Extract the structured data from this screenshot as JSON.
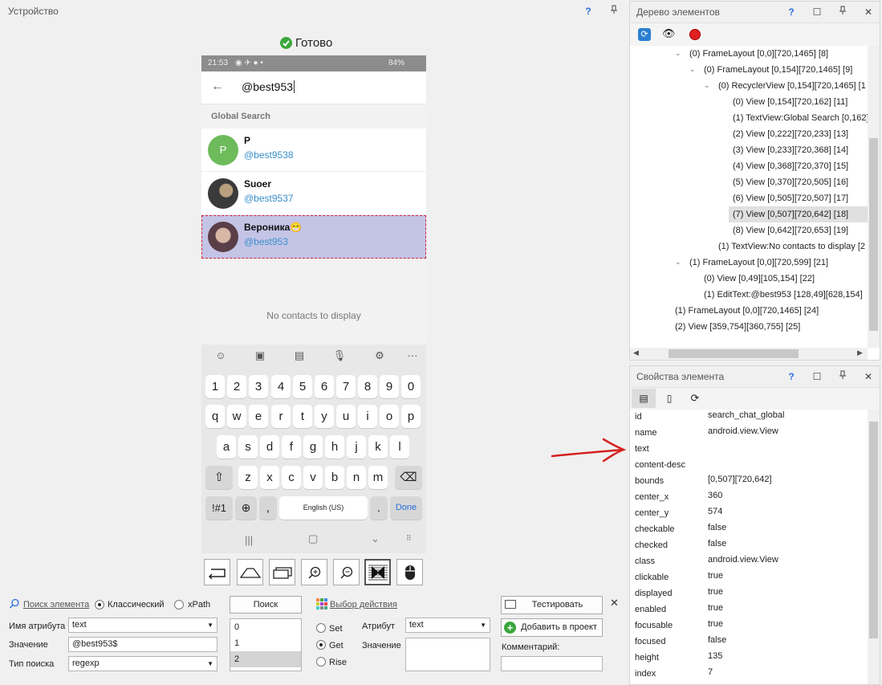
{
  "device_panel": {
    "title": "Устройство",
    "help": "?",
    "pin": "⊥",
    "status": "Готово"
  },
  "phone": {
    "statusbar": {
      "time": "21:53",
      "battery": "84%"
    },
    "search_text": "@best953",
    "section_label": "Global Search",
    "contacts": [
      {
        "initial": "P",
        "name": "P",
        "handle": "@best9538",
        "avatar_color": "#6dbb5a"
      },
      {
        "initial": "",
        "name": "Suoer",
        "handle": "@best9537",
        "avatar_color": "#4a4a4a"
      },
      {
        "initial": "",
        "name": "Вероника😁",
        "handle": "@best953",
        "avatar_color": "#6b4e57"
      }
    ],
    "empty_text": "No contacts to display",
    "keyboard": {
      "row_numbers": [
        "1",
        "2",
        "3",
        "4",
        "5",
        "6",
        "7",
        "8",
        "9",
        "0"
      ],
      "row_q": [
        "q",
        "w",
        "e",
        "r",
        "t",
        "y",
        "u",
        "i",
        "o",
        "p"
      ],
      "row_a": [
        "a",
        "s",
        "d",
        "f",
        "g",
        "h",
        "j",
        "k",
        "l"
      ],
      "row_z": [
        "z",
        "x",
        "c",
        "v",
        "b",
        "n",
        "m"
      ],
      "sym": "!#1",
      "comma": ",",
      "space": "English (US)",
      "period": ".",
      "done": "Done"
    }
  },
  "search_panel": {
    "search_link": "Поиск элемента",
    "mode_classic": "Классический",
    "mode_xpath": "xPath",
    "search_button": "Поиск",
    "attr_name_label": "Имя атрибута",
    "attr_name_value": "text",
    "value_label": "Значение",
    "value_value": "@best953$",
    "search_type_label": "Тип поиска",
    "search_type_value": "regexp",
    "results": [
      "0",
      "1",
      "2"
    ],
    "action_link": "Выбор действия",
    "set_label": "Set",
    "get_label": "Get",
    "rise_label": "Rise",
    "attribute_label": "Атрибут",
    "attribute_value": "text",
    "action_value_label": "Значение",
    "test_button": "Тестировать",
    "add_button": "Добавить в проект",
    "comment_label": "Комментарий:"
  },
  "tree_panel": {
    "title": "Дерево элементов",
    "help": "?",
    "rows": [
      {
        "text": "(0) FrameLayout [0,0][720,1465] [8]"
      },
      {
        "text": "(0) FrameLayout [0,154][720,1465] [9]"
      },
      {
        "text": "(0) RecyclerView [0,154][720,1465] [1"
      },
      {
        "text": "(0) View [0,154][720,162] [11]"
      },
      {
        "text": "(1) TextView:Global Search [0,162]"
      },
      {
        "text": "(2) View [0,222][720,233] [13]"
      },
      {
        "text": "(3) View [0,233][720,368] [14]"
      },
      {
        "text": "(4) View [0,368][720,370] [15]"
      },
      {
        "text": "(5) View [0,370][720,505] [16]"
      },
      {
        "text": "(6) View [0,505][720,507] [17]"
      },
      {
        "text": "(7) View [0,507][720,642] [18]"
      },
      {
        "text": "(8) View [0,642][720,653] [19]"
      },
      {
        "text": "(1) TextView:No contacts to display [2"
      },
      {
        "text": "(1) FrameLayout [0,0][720,599] [21]"
      },
      {
        "text": "(0) View [0,49][105,154] [22]"
      },
      {
        "text": "(1) EditText:@best953 [128,49][628,154]"
      },
      {
        "text": "(1) FrameLayout [0,0][720,1465] [24]"
      },
      {
        "text": "(2) View [359,754][360,755] [25]"
      }
    ]
  },
  "props_panel": {
    "title": "Свойства элемента",
    "help": "?",
    "rows": [
      {
        "key": "id",
        "value": "search_chat_global"
      },
      {
        "key": "name",
        "value": "android.view.View"
      },
      {
        "key": "text",
        "value": ""
      },
      {
        "key": "content-desc",
        "value": ""
      },
      {
        "key": "bounds",
        "value": "[0,507][720,642]"
      },
      {
        "key": "center_x",
        "value": "360"
      },
      {
        "key": "center_y",
        "value": "574"
      },
      {
        "key": "checkable",
        "value": "false"
      },
      {
        "key": "checked",
        "value": "false"
      },
      {
        "key": "class",
        "value": "android.view.View"
      },
      {
        "key": "clickable",
        "value": "true"
      },
      {
        "key": "displayed",
        "value": "true"
      },
      {
        "key": "enabled",
        "value": "true"
      },
      {
        "key": "focusable",
        "value": "true"
      },
      {
        "key": "focused",
        "value": "false"
      },
      {
        "key": "height",
        "value": "135"
      },
      {
        "key": "index",
        "value": "7"
      }
    ]
  },
  "colors": {
    "accent_blue": "#2a6fdb",
    "selection_fill": "#c4c4e6",
    "selection_border": "#d0253a",
    "annotation_arrow": "#d42020",
    "ready_green": "#3aa63a"
  }
}
